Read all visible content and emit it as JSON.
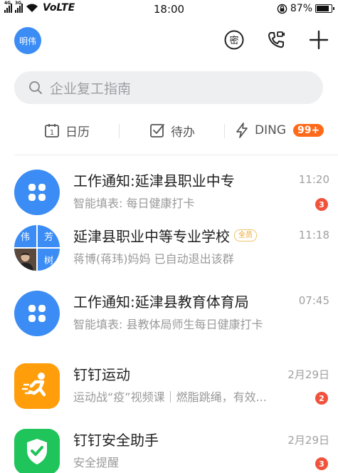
{
  "status_bar": {
    "time": "18:00",
    "network": "VoLTE",
    "sim1": "4G",
    "sim2": "3G",
    "battery": "87%",
    "battery_level": 0.87
  },
  "header": {
    "avatar_text": "明伟",
    "accent": "#3b8cf4"
  },
  "search": {
    "placeholder": "企业复工指南"
  },
  "quick_bar": {
    "calendar": "日历",
    "calendar_day": "1",
    "todo": "待办",
    "ding": "DING",
    "ding_badge": "99+"
  },
  "conversations": [
    {
      "title": "工作通知:延津县职业中专",
      "subtitle": "智能填表: 每日健康打卡",
      "time": "11:20",
      "unread": "3",
      "icon": "work-notice-icon"
    },
    {
      "title": "延津县职业中等专业学校",
      "tag": "全员",
      "subtitle": "蒋博(蒋玮)妈妈 已自动退出该群",
      "time": "11:18",
      "avatar_chars": [
        "伟",
        "芳",
        "树"
      ]
    },
    {
      "title": "工作通知:延津县教育体育局",
      "subtitle": "智能填表: 县教体局师生每日健康打卡",
      "time": "07:45",
      "icon": "work-notice-icon"
    },
    {
      "title": "钉钉运动",
      "subtitle": "运动战“疫”视频课｜燃脂跳绳，有效...",
      "time": "2月29日",
      "unread": "2",
      "icon": "running-person-icon"
    },
    {
      "title": "钉钉安全助手",
      "subtitle": "安全提醒",
      "time": "2月29日",
      "unread": "3",
      "icon": "shield-check-icon"
    }
  ],
  "colors": {
    "blue": "#3b8cf4",
    "orange": "#ff9d0a",
    "green": "#1fc45a",
    "badge_red": "#f0523c",
    "ding_orange": "#ff6a1a"
  }
}
